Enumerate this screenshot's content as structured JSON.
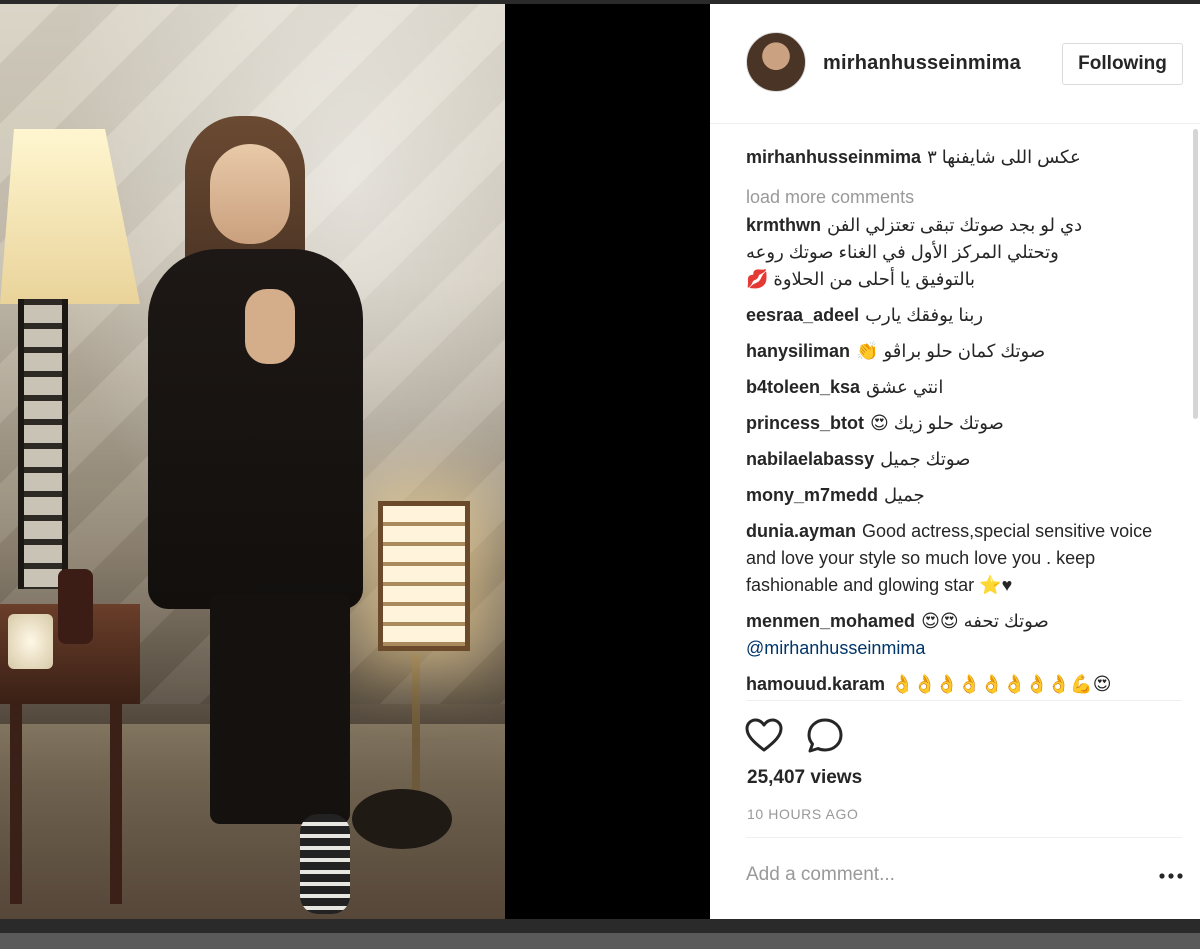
{
  "post": {
    "username": "mirhanhusseinmima",
    "follow_label": "Following",
    "caption": {
      "user": "mirhanhusseinmima",
      "text": "عكس اللى شايفنها ٣"
    },
    "load_more": "load more comments",
    "comments": [
      {
        "user": "krmthwn",
        "lines": [
          "دي لو بجد صوتك تبقى تعتزلي الفن",
          "وتحتلي المركز الأول في الغناء صوتك روعه",
          "بالتوفيق يا أحلى من الحلاوة 💋"
        ]
      },
      {
        "user": "eesraa_adeel",
        "text": "ربنا يوفقك يارب"
      },
      {
        "user": "hanysiliman",
        "text": "صوتك كمان حلو براڤو 👏"
      },
      {
        "user": "b4toleen_ksa",
        "text": "انتي عشق"
      },
      {
        "user": "princess_btot",
        "text": "صوتك حلو زيك 😍"
      },
      {
        "user": "nabilaelabassy",
        "text": "صوتك جميل"
      },
      {
        "user": "mony_m7medd",
        "text": "جميل"
      },
      {
        "user": "dunia.ayman",
        "text": "Good actress,special sensitive voice and love your style so much love you . keep fashionable and glowing star ⭐♥"
      },
      {
        "user": "menmen_mohamed",
        "text": "صوتك تحفه 😍😍",
        "mention": "@mirhanhusseinmima"
      },
      {
        "user": "hamouud.karam",
        "text": "👌👌👌👌👌👌👌👌💪😍"
      }
    ],
    "views": "25,407 views",
    "time": "10 HOURS AGO",
    "add_comment_placeholder": "Add a comment...",
    "icons": {
      "like": "heart-icon",
      "comment": "speech-bubble-icon",
      "more": "more-options-icon"
    }
  }
}
